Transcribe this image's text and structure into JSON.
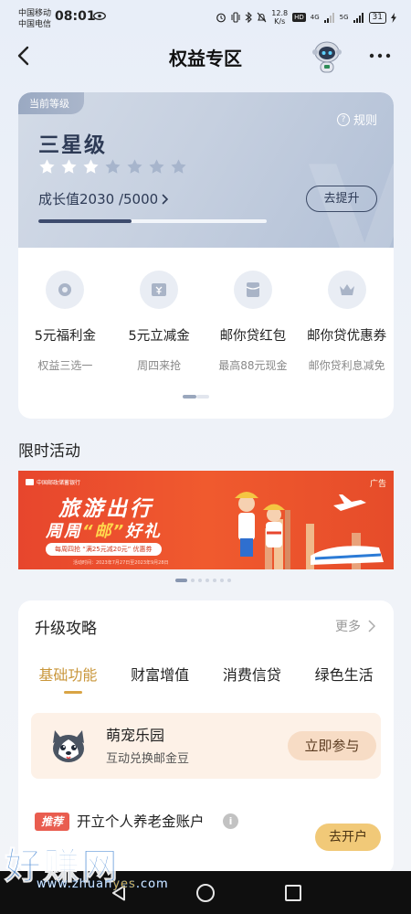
{
  "status_bar": {
    "carrier_1": "中国移动",
    "carrier_2": "中国电信",
    "time": "08:01",
    "net_speed_value": "12.8",
    "net_speed_unit": "K/s",
    "hd_label": "HD",
    "signal_1": "4G",
    "signal_2": "5G",
    "battery": "31"
  },
  "nav": {
    "title": "权益专区"
  },
  "member_card": {
    "tag": "当前等级",
    "rules_label": "规则",
    "level_name": "三星级",
    "stars_total": 7,
    "stars_filled": 3,
    "growth_text": "成长值2030 /5000",
    "progress_fraction": 0.406,
    "improve_button": "去提升",
    "benefits": [
      {
        "title": "5元福利金",
        "sub": "权益三选一",
        "icon": "coin-icon"
      },
      {
        "title": "5元立减金",
        "sub": "周四来抢",
        "icon": "ticket-icon"
      },
      {
        "title": "邮你贷红包",
        "sub": "最高88元现金",
        "icon": "red-packet-icon"
      },
      {
        "title": "邮你贷优惠券",
        "sub": "邮你贷利息减免",
        "icon": "crown-icon"
      }
    ]
  },
  "limited": {
    "section_title": "限时活动",
    "banner": {
      "bank_name": "中国邮政储蓄银行",
      "ad_tag": "广告",
      "headline": "旅游出行",
      "subline_prefix": "周周",
      "subline_highlight": "“邮”",
      "subline_suffix": "好礼",
      "pill_text": "每周四抢 “满25元减20元” 优惠券",
      "fine_print": "活动时间：2023年7月27日至2023年9月28日"
    }
  },
  "guide": {
    "title": "升级攻略",
    "more": "更多",
    "tabs": [
      "基础功能",
      "财富增值",
      "消费信贷",
      "绿色生活"
    ],
    "active_tab": 0,
    "pet": {
      "title": "萌宠乐园",
      "sub": "互动兑换邮金豆",
      "button": "立即参与"
    },
    "pension": {
      "tag": "推荐",
      "title": "开立个人养老金账户",
      "button": "去开户"
    }
  },
  "watermark": {
    "text": "好赚网",
    "url_prefix": "www.zhuan",
    "url_highlight": "yes",
    "url_suffix": ".com"
  },
  "colors": {
    "accent_gold": "#d9a444",
    "level_text": "#2d3a55",
    "banner_red": "#e7462d"
  }
}
